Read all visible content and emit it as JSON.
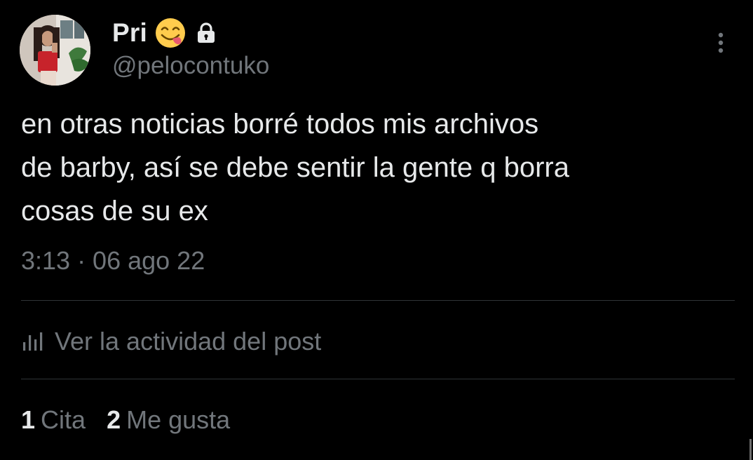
{
  "author": {
    "display_name": "Pri",
    "handle": "@pelocontuko",
    "verified_icon": "face-savoring-food-emoji",
    "protected_icon": "lock-icon"
  },
  "post": {
    "text": "en otras noticias borré todos mis archivos\nde barby, así se debe sentir la gente q borra\ncosas de su ex",
    "timestamp": "3:13 · 06 ago 22"
  },
  "activity": {
    "icon": "analytics-bars-icon",
    "label": "Ver la actividad del post"
  },
  "stats": [
    {
      "count": "1",
      "label": "Cita"
    },
    {
      "count": "2",
      "label": "Me gusta"
    }
  ],
  "more_icon": "more-vertical-icon",
  "colors": {
    "background": "#000000",
    "primary_text": "#e7e9ea",
    "secondary_text": "#71767b",
    "divider": "#2f3336"
  }
}
